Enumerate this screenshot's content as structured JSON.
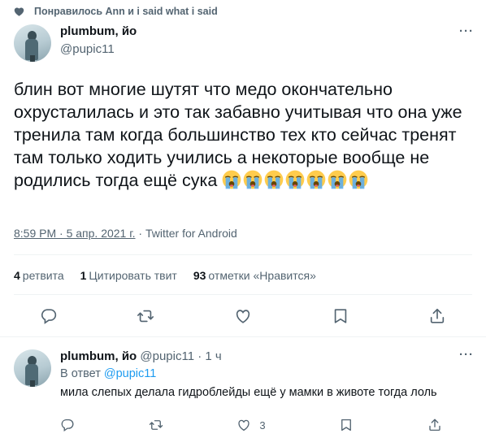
{
  "social_context": {
    "text": "Понравилось Ann и i said what i said",
    "icon": "heart-icon"
  },
  "main_tweet": {
    "author": {
      "name": "plumbum, йо",
      "handle": "@pupic11"
    },
    "more_label": "···",
    "text": "блин вот многие шутят что медо окончательно охрусталилась и это так забавно учитывая что она уже тренила там когда большинство тех кто сейчас тренят там только ходить учились а некоторые вообще не родились тогда ещё сука",
    "emojis": [
      "loudly-crying-face",
      "loudly-crying-face",
      "loudly-crying-face",
      "loudly-crying-face",
      "loudly-crying-face",
      "loudly-crying-face",
      "loudly-crying-face"
    ],
    "time": "8:59 PM · 5 апр. 2021 г.",
    "separator": " · ",
    "source": "Twitter for Android",
    "stats": {
      "retweets_count": "4",
      "retweets_label": "ретвита",
      "quotes_count": "1",
      "quotes_label": "Цитировать твит",
      "likes_count": "93",
      "likes_label": "отметки «Нравится»"
    },
    "actions": [
      "reply-icon",
      "retweet-icon",
      "like-icon",
      "share-icon",
      "share-up-icon"
    ]
  },
  "reply_tweet": {
    "author": {
      "name": "plumbum, йо",
      "handle": "@pupic11",
      "time": "1 ч"
    },
    "more_label": "···",
    "replying_to_label": "В ответ",
    "replying_to_handle": "@pupic11",
    "text": "мила слепых делала гидроблейды ещё у мамки в животе тогда лоль",
    "like_count": "3",
    "actions": [
      "reply-icon",
      "retweet-icon",
      "like-icon",
      "share-icon",
      "share-up-icon"
    ]
  },
  "colors": {
    "text": "#0f1419",
    "secondary": "#536471",
    "accent": "#1d9bf0",
    "divider": "#eff3f4"
  }
}
